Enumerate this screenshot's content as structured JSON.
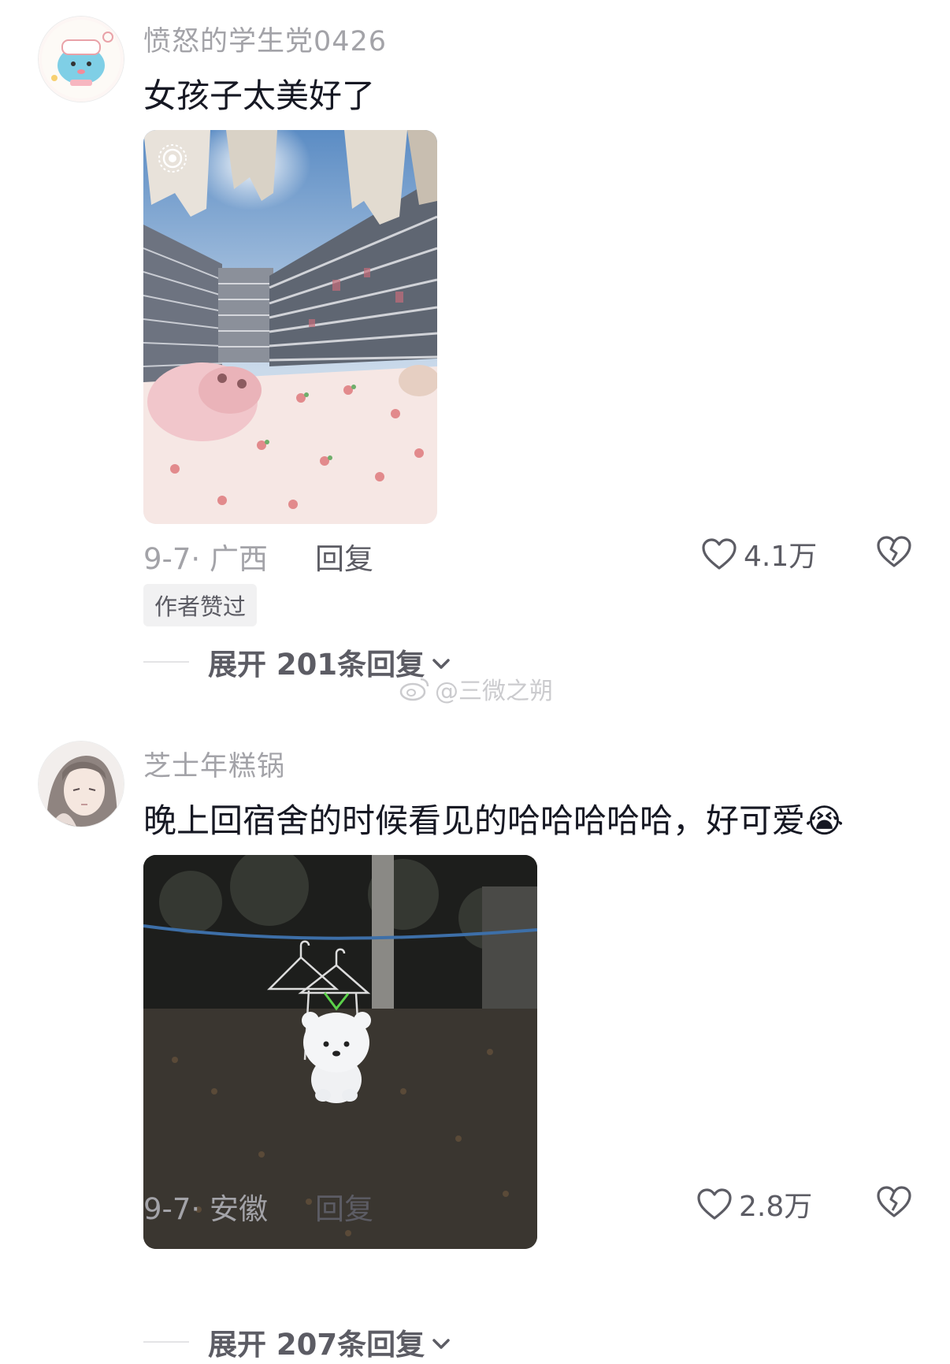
{
  "comments": [
    {
      "username": "愤怒的学生党0426",
      "text": "女孩子太美好了",
      "date_location": "9-7· 广西",
      "reply_label": "回复",
      "likes": "4.1万",
      "badge": "作者赞过",
      "expand_label": "展开 201条回复",
      "photo_icon": "live-photo-icon"
    },
    {
      "username": "芝士年糕锅",
      "text": "晚上回宿舍的时候看见的哈哈哈哈哈，好可爱",
      "emoji": "😭",
      "date_location": "9-7· 安徽",
      "reply_label": "回复",
      "likes": "2.8万",
      "expand_label": "展开 207条回复"
    }
  ],
  "watermark": "@三微之朔",
  "colors": {
    "username": "#a3a3a8",
    "body_text": "#161823",
    "secondary": "#5c5c64",
    "badge_bg": "#f1f1f2"
  }
}
